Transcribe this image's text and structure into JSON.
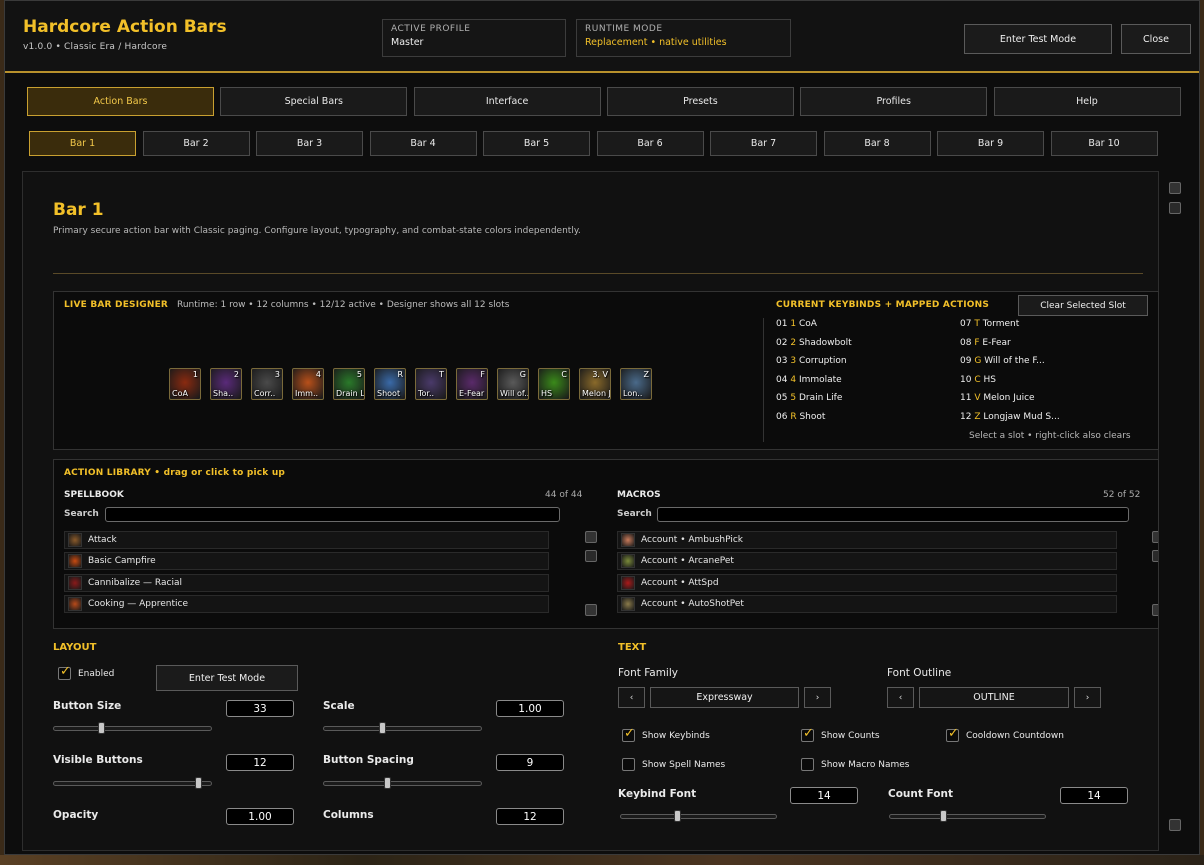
{
  "header": {
    "title": "Hardcore Action Bars",
    "subtitle": "v1.0.0  •  Classic Era / Hardcore",
    "active_profile_label": "ACTIVE PROFILE",
    "active_profile_value": "Master",
    "runtime_mode_label": "RUNTIME MODE",
    "runtime_mode_value": "Replacement • native utilities",
    "test_mode_button": "Enter Test Mode",
    "close_button": "Close"
  },
  "main_tabs": [
    "Action Bars",
    "Special Bars",
    "Interface",
    "Presets",
    "Profiles",
    "Help"
  ],
  "main_tab_active": 0,
  "bar_tabs": [
    "Bar 1",
    "Bar 2",
    "Bar 3",
    "Bar 4",
    "Bar 5",
    "Bar 6",
    "Bar 7",
    "Bar 8",
    "Bar 9",
    "Bar 10"
  ],
  "bar_tab_active": 0,
  "bar": {
    "title": "Bar 1",
    "description": "Primary secure action bar with Classic paging. Configure layout, typography, and combat-state colors independently."
  },
  "designer": {
    "label": "LIVE BAR DESIGNER",
    "runtime": "Runtime: 1 row • 12 columns • 12/12 active • Designer shows all 12 slots",
    "slots": [
      {
        "abbr": "CoA",
        "key": "1",
        "color": "#8a2a10"
      },
      {
        "abbr": "Sha..",
        "key": "2",
        "color": "#5a2a7a"
      },
      {
        "abbr": "Corr..",
        "key": "3",
        "color": "#4a4a4a"
      },
      {
        "abbr": "Imm..",
        "key": "4",
        "color": "#b8501a"
      },
      {
        "abbr": "Drain Life",
        "key": "5",
        "color": "#2a7a2a"
      },
      {
        "abbr": "Shoot",
        "key": "R",
        "color": "#3a6aa8"
      },
      {
        "abbr": "Tor..",
        "key": "T",
        "color": "#4a3a6a"
      },
      {
        "abbr": "E-Fear",
        "key": "F",
        "color": "#5a2a6a"
      },
      {
        "abbr": "Will of..",
        "key": "G",
        "color": "#5a5a5a"
      },
      {
        "abbr": "HS",
        "key": "C",
        "color": "#3a8a1a"
      },
      {
        "abbr": "Melon J..",
        "key": "3. V",
        "color": "#8a6a2a"
      },
      {
        "abbr": "Lon..",
        "key": "Z",
        "color": "#4a6a8a"
      }
    ]
  },
  "keybinds": {
    "label": "CURRENT KEYBINDS + MAPPED ACTIONS",
    "clear_button": "Clear Selected Slot",
    "left": [
      {
        "num": "01",
        "key": "1",
        "action": "CoA"
      },
      {
        "num": "02",
        "key": "2",
        "action": "Shadowbolt"
      },
      {
        "num": "03",
        "key": "3",
        "action": "Corruption"
      },
      {
        "num": "04",
        "key": "4",
        "action": "Immolate"
      },
      {
        "num": "05",
        "key": "5",
        "action": "Drain Life"
      },
      {
        "num": "06",
        "key": "R",
        "action": "Shoot"
      }
    ],
    "right": [
      {
        "num": "07",
        "key": "T",
        "action": "Torment"
      },
      {
        "num": "08",
        "key": "F",
        "action": "E-Fear"
      },
      {
        "num": "09",
        "key": "G",
        "action": "Will of the F..."
      },
      {
        "num": "10",
        "key": "C",
        "action": "HS"
      },
      {
        "num": "11",
        "key": "V",
        "action": "Melon Juice"
      },
      {
        "num": "12",
        "key": "Z",
        "action": "Longjaw Mud S..."
      }
    ],
    "hint": "Select a slot • right-click also clears"
  },
  "library": {
    "label": "ACTION LIBRARY • drag or click to pick up",
    "spellbook": {
      "label": "SPELLBOOK",
      "count": "44 of 44",
      "search_label": "Search",
      "items": [
        {
          "name": "Attack",
          "color": "#8a5a2a"
        },
        {
          "name": "Basic Campfire",
          "color": "#c84a10"
        },
        {
          "name": "Cannibalize — Racial",
          "color": "#8a1a1a"
        },
        {
          "name": "Cooking — Apprentice",
          "color": "#b84a1a"
        }
      ]
    },
    "macros": {
      "label": "MACROS",
      "count": "52 of 52",
      "search_label": "Search",
      "items": [
        {
          "name": "Account • AmbushPick",
          "color": "#c87a5a"
        },
        {
          "name": "Account • ArcanePet",
          "color": "#7a8a3a"
        },
        {
          "name": "Account • AttSpd",
          "color": "#aa1a1a"
        },
        {
          "name": "Account • AutoShotPet",
          "color": "#8a7a4a"
        }
      ]
    }
  },
  "layout": {
    "label": "LAYOUT",
    "enabled_label": "Enabled",
    "enabled": true,
    "test_mode_button": "Enter Test Mode",
    "button_size_label": "Button Size",
    "button_size": "33",
    "scale_label": "Scale",
    "scale": "1.00",
    "visible_buttons_label": "Visible Buttons",
    "visible_buttons": "12",
    "button_spacing_label": "Button Spacing",
    "button_spacing": "9",
    "opacity_label": "Opacity",
    "opacity": "1.00",
    "columns_label": "Columns",
    "columns": "12"
  },
  "text": {
    "label": "TEXT",
    "font_family_label": "Font Family",
    "font_family": "Expressway",
    "font_outline_label": "Font Outline",
    "font_outline": "OUTLINE",
    "prev_glyph": "‹",
    "next_glyph": "›",
    "show_keybinds": "Show Keybinds",
    "show_counts": "Show Counts",
    "cooldown_countdown": "Cooldown Countdown",
    "show_spell_names": "Show Spell Names",
    "show_macro_names": "Show Macro Names",
    "keybind_font_label": "Keybind Font",
    "keybind_font": "14",
    "count_font_label": "Count Font",
    "count_font": "14"
  },
  "colors": {
    "accent": "#f2c029",
    "panel": "#0b0b0b",
    "active_tab": "#3a2c0c"
  }
}
